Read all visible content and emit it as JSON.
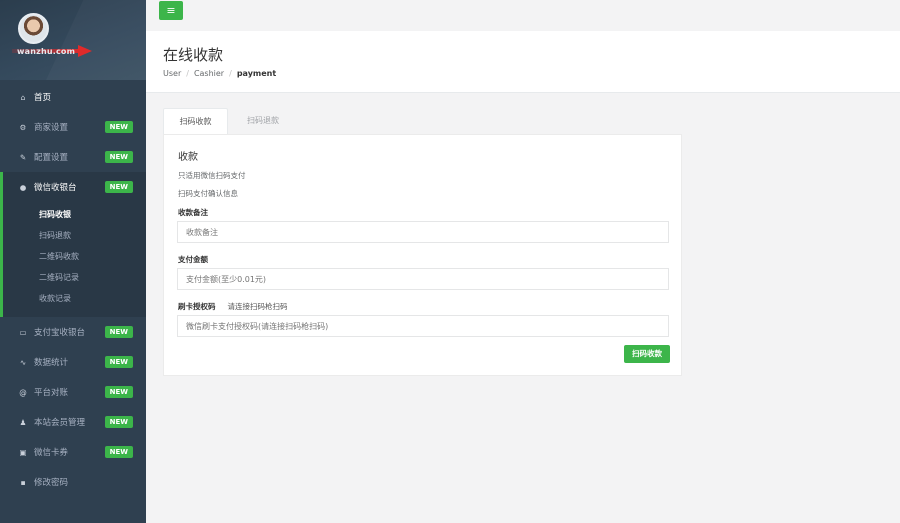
{
  "sidebar": {
    "site_name": "wanzhu.com",
    "items": [
      {
        "icon": "home-icon",
        "glyph": "⌂",
        "label": "首页"
      },
      {
        "icon": "gears-icon",
        "glyph": "⚙",
        "label": "商家设置",
        "badge": "NEW"
      },
      {
        "icon": "wrench-icon",
        "glyph": "✎",
        "label": "配置设置",
        "badge": "NEW"
      },
      {
        "icon": "wechat-icon",
        "glyph": "●",
        "label": "微信收银台",
        "badge": "NEW"
      },
      {
        "icon": "laptop-icon",
        "glyph": "▭",
        "label": "支付宝收银台",
        "badge": "NEW"
      },
      {
        "icon": "chart-icon",
        "glyph": "∿",
        "label": "数据统计",
        "badge": "NEW"
      },
      {
        "icon": "at-icon",
        "glyph": "@",
        "label": "平台对账",
        "badge": "NEW"
      },
      {
        "icon": "user-icon",
        "glyph": "♟",
        "label": "本站会员管理",
        "badge": "NEW"
      },
      {
        "icon": "card-icon",
        "glyph": "▣",
        "label": "微信卡券",
        "badge": "NEW"
      },
      {
        "icon": "lock-icon",
        "glyph": "▪",
        "label": "修改密码"
      }
    ],
    "subitems": [
      "扫码收银",
      "扫码退款",
      "二维码收款",
      "二维码记录",
      "收款记录"
    ]
  },
  "top": {
    "menu_glyph": "≡"
  },
  "page": {
    "title": "在线收款",
    "breadcrumb": [
      "User",
      "Cashier",
      "payment"
    ]
  },
  "tabs": [
    "扫码收款",
    "扫码退款"
  ],
  "form": {
    "heading": "收款",
    "note1": "只适用微信扫码支付",
    "note2": "扫码支付确认信息",
    "remark_label": "收款备注",
    "remark_placeholder": "收款备注",
    "amount_label": "支付金额",
    "amount_placeholder": "支付金额(至少0.01元)",
    "auth_label": "刷卡授权码",
    "auth_hint": "请连接扫码枪扫码",
    "auth_placeholder": "微信刷卡支付授权码(请连接扫码枪扫码)",
    "submit_label": "扫码收款"
  },
  "colors": {
    "accent": "#3cb54a",
    "sidebar": "#2f4050"
  }
}
